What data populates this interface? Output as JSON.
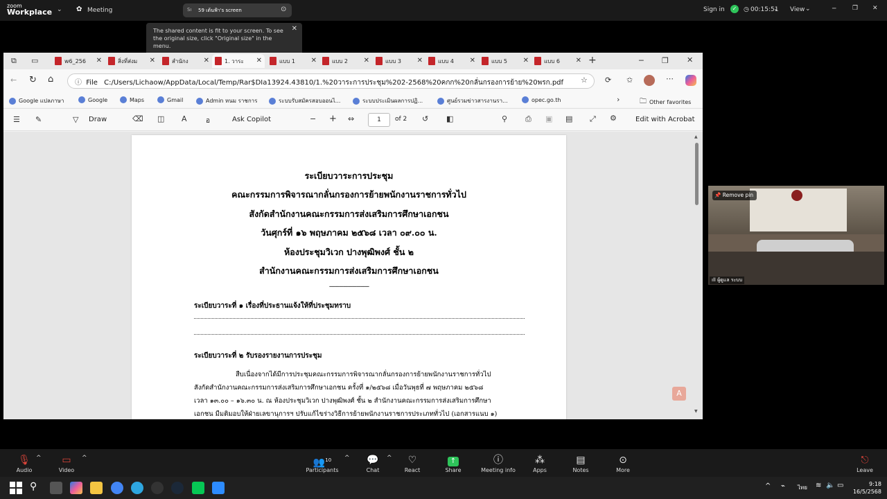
{
  "zoom": {
    "brand_line1": "zoom",
    "brand_line2": "Workplace",
    "meeting_label": "Meeting",
    "share_pill_initials": "Sı",
    "share_pill_label": "59 เต้นฟ้า's screen",
    "tooltip": "The shared content is fit to your screen. To see the original size, click \"Original size\" in the menu.",
    "signin": "Sign in",
    "timer": "00:15:51",
    "view_label": "View"
  },
  "browser": {
    "tabs": [
      {
        "label": "w6_256"
      },
      {
        "label": "สิ่งที่ส่งม"
      },
      {
        "label": "สำนักง"
      },
      {
        "label": "1. วาระ"
      },
      {
        "label": "แบบ 1"
      },
      {
        "label": "แบบ 2"
      },
      {
        "label": "แบบ 3"
      },
      {
        "label": "แบบ 4"
      },
      {
        "label": "แบบ 5"
      },
      {
        "label": "แบบ 6"
      }
    ],
    "file_label": "File",
    "url": "C:/Users/Lichaow/AppData/Local/Temp/Rar$DIa13924.43810/1.%20วาระการประชุม%202-2568%20คกก%20กลั่นกรองการย้าย%20พรก.pdf",
    "bookmarks": [
      "Google แปลภาษา",
      "Google",
      "Maps",
      "Gmail",
      "Admin หนม ราชการ",
      "ระบบรับสมัครสอบออนไ...",
      "ระบบประเมินผลการปฏิ...",
      "ศูนย์รวมข่าวสารงานรา...",
      "opec.go.th"
    ],
    "other_favorites": "Other favorites",
    "pdf_toolbar": {
      "draw": "Draw",
      "read_aloud": "อ",
      "ask_copilot": "Ask Copilot",
      "page_current": "1",
      "page_total": "of 2",
      "edit_acrobat": "Edit with Acrobat"
    }
  },
  "document": {
    "title_lines": [
      "ระเบียบวาระการประชุม",
      "คณะกรรมการพิจารณากลั่นกรองการย้ายพนักงานราชการทั่วไป",
      "สังกัดสำนักงานคณะกรรมการส่งเสริมการศึกษาเอกชน",
      "วันศุกร์ที่  ๑๖  พฤษภาคม  ๒๕๖๘  เวลา ๐๙.๐๐ น.",
      "ห้องประชุมวิเวก ปางพุฒิพงศ์ ชั้น ๒",
      "สำนักงานคณะกรรมการส่งเสริมการศึกษาเอกชน"
    ],
    "separator": "----------------------------",
    "agenda1": "ระเบียบวาระที่ ๑ เรื่องที่ประธานแจ้งให้ที่ประชุมทราบ",
    "agenda2": "ระเบียบวาระที่ ๒ รับรองรายงานการประชุม",
    "body_lines": [
      "สืบเนื่องจากได้มีการประชุมคณะกรรมการพิจารณากลั่นกรองการย้ายพนักงานราชการทั่วไป",
      "สังกัดสำนักงานคณะกรรมการส่งเสริมการศึกษาเอกชน ครั้งที่ ๑/๒๕๖๘ เมื่อวันพุธที่ ๗ พฤษภาคม ๒๕๖๘",
      "เวลา ๑๓.๐๐ – ๑๖.๓๐ น. ณ ห้องประชุมวิเวก ปางพุฒิพงศ์ ชั้น ๒ สำนักงานคณะกรรมการส่งเสริมการศึกษา",
      "เอกชน มีมติมอบให้ฝ่ายเลขานุการฯ ปรับแก้ไขร่างวิธีการย้ายพนักงานราชการประเภททั่วไป (เอกสารแนบ ๑)"
    ]
  },
  "video": {
    "remove_pin": "Remove pin",
    "participant_name": "ผู้ดูแล ระบบ"
  },
  "toolbar": {
    "audio": "Audio",
    "video": "Video",
    "participants": "Participants",
    "participants_count": "10",
    "chat": "Chat",
    "react": "React",
    "share": "Share",
    "meeting_info": "Meeting info",
    "apps": "Apps",
    "notes": "Notes",
    "more": "More",
    "leave": "Leave"
  },
  "taskbar": {
    "lang": "ไทย",
    "time": "9:18",
    "date": "16/5/2568"
  },
  "colors": {
    "share_green": "#2ec45a",
    "leave_red": "#e0453a",
    "pdf_red": "#c4252a"
  }
}
